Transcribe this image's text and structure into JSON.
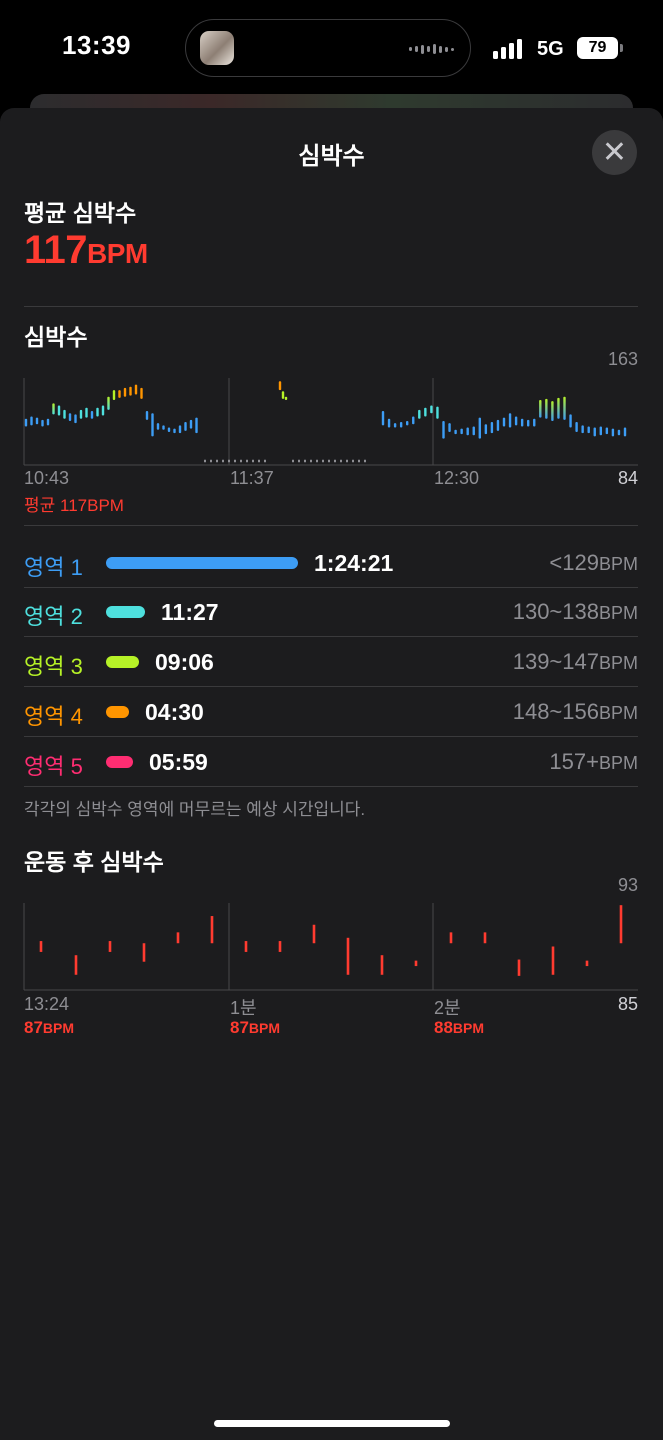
{
  "status": {
    "time": "13:39",
    "network": "5G",
    "battery": "79"
  },
  "sheet": {
    "title": "심박수",
    "close_icon": "xmark-icon"
  },
  "average": {
    "label": "평균 심박수",
    "value": "117",
    "unit": "BPM"
  },
  "hr_chart": {
    "title": "심박수",
    "ymax_label": "163",
    "ymin_label": "84",
    "x_labels": [
      "10:43",
      "11:37",
      "12:30"
    ],
    "avg_label": "평균 117BPM"
  },
  "zones": [
    {
      "label": "영역 1",
      "time": "1:24:21",
      "range": "<129",
      "unit": "BPM",
      "color": "#3d9df5"
    },
    {
      "label": "영역 2",
      "time": "11:27",
      "range": "130~138",
      "unit": "BPM",
      "color": "#4ee0de"
    },
    {
      "label": "영역 3",
      "time": "09:06",
      "range": "139~147",
      "unit": "BPM",
      "color": "#b6f227"
    },
    {
      "label": "영역 4",
      "time": "04:30",
      "range": "148~156",
      "unit": "BPM",
      "color": "#ff9500"
    },
    {
      "label": "영역 5",
      "time": "05:59",
      "range": "157+",
      "unit": "BPM",
      "color": "#ff2d72"
    }
  ],
  "zone_note": "각각의 심박수 영역에 머무르는 예상 시간입니다.",
  "recovery": {
    "title": "운동 후 심박수",
    "ymax_label": "93",
    "ymin_label": "85",
    "x_labels": [
      "13:24",
      "1분",
      "2분"
    ],
    "bpm_values": [
      "87",
      "87",
      "88"
    ],
    "unit": "BPM"
  },
  "chart_data": [
    {
      "type": "bar",
      "title": "심박수",
      "ylim": [
        84,
        163
      ],
      "ytick_labels": [
        "163",
        "84"
      ],
      "x_labels": [
        "10:43",
        "11:37",
        "12:30"
      ],
      "annotation": "평균 117BPM",
      "series": [
        {
          "values": [
            [
              119,
              126
            ],
            [
              120,
              128
            ],
            [
              121,
              127
            ],
            [
              119,
              125
            ],
            [
              120,
              126
            ],
            [
              130,
              140
            ],
            [
              129,
              138
            ],
            [
              126,
              134
            ],
            [
              124,
              131
            ],
            [
              122,
              130
            ],
            [
              126,
              134
            ],
            [
              127,
              136
            ],
            [
              126,
              133
            ],
            [
              128,
              136
            ],
            [
              129,
              138
            ],
            [
              134,
              146
            ],
            [
              143,
              152
            ],
            [
              145,
              152
            ],
            [
              146,
              154
            ],
            [
              147,
              155
            ],
            [
              148,
              157
            ],
            [
              144,
              154
            ],
            [
              125,
              133
            ],
            [
              110,
              131
            ],
            [
              116,
              122
            ],
            [
              116,
              120
            ],
            [
              114,
              118
            ],
            [
              113,
              117
            ],
            [
              113,
              120
            ],
            [
              115,
              123
            ],
            [
              117,
              125
            ],
            [
              113,
              127
            ],
            [
              152,
              160
            ],
            [
              144,
              151
            ],
            [
              143,
              146
            ],
            [
              120,
              133
            ],
            [
              118,
              126
            ],
            [
              118,
              122
            ],
            [
              118,
              123
            ],
            [
              120,
              124
            ],
            [
              121,
              128
            ],
            [
              126,
              134
            ],
            [
              128,
              136
            ],
            [
              131,
              138
            ],
            [
              126,
              137
            ],
            [
              108,
              124
            ],
            [
              114,
              122
            ],
            [
              112,
              116
            ],
            [
              112,
              117
            ],
            [
              111,
              118
            ],
            [
              111,
              119
            ],
            [
              108,
              127
            ],
            [
              112,
              121
            ],
            [
              113,
              123
            ],
            [
              115,
              125
            ],
            [
              119,
              127
            ],
            [
              118,
              131
            ],
            [
              120,
              128
            ],
            [
              119,
              126
            ],
            [
              119,
              125
            ],
            [
              119,
              126
            ],
            [
              127,
              143
            ],
            [
              126,
              144
            ],
            [
              124,
              142
            ],
            [
              126,
              145
            ],
            [
              125,
              146
            ],
            [
              118,
              130
            ],
            [
              114,
              123
            ],
            [
              113,
              120
            ],
            [
              113,
              119
            ],
            [
              110,
              118
            ],
            [
              111,
              119
            ],
            [
              112,
              118
            ],
            [
              110,
              117
            ],
            [
              111,
              116
            ],
            [
              110,
              118
            ]
          ]
        }
      ]
    },
    {
      "type": "bar",
      "title": "운동 후 심박수",
      "ylim": [
        85,
        93
      ],
      "ytick_labels": [
        "93",
        "85"
      ],
      "x_labels": [
        "13:24",
        "1분",
        "2분"
      ],
      "annotations": [
        "87BPM",
        "87BPM",
        "88BPM"
      ],
      "series": [
        {
          "values": [
            [
              88.5,
              89.5
            ],
            [
              86.4,
              88.2
            ],
            [
              88.5,
              89.5
            ],
            [
              87.6,
              89.3
            ],
            [
              89.3,
              90.3
            ],
            [
              89.3,
              91.8
            ],
            [
              88.5,
              89.5
            ],
            [
              88.5,
              89.5
            ],
            [
              89.3,
              91.0
            ],
            [
              86.4,
              89.8
            ],
            [
              86.4,
              88.2
            ],
            [
              87.2,
              87.7
            ],
            [
              89.3,
              90.3
            ],
            [
              89.3,
              90.3
            ],
            [
              86.3,
              87.8
            ],
            [
              86.4,
              89.0
            ],
            [
              87.2,
              87.7
            ],
            [
              89.3,
              92.8
            ]
          ]
        }
      ]
    }
  ]
}
